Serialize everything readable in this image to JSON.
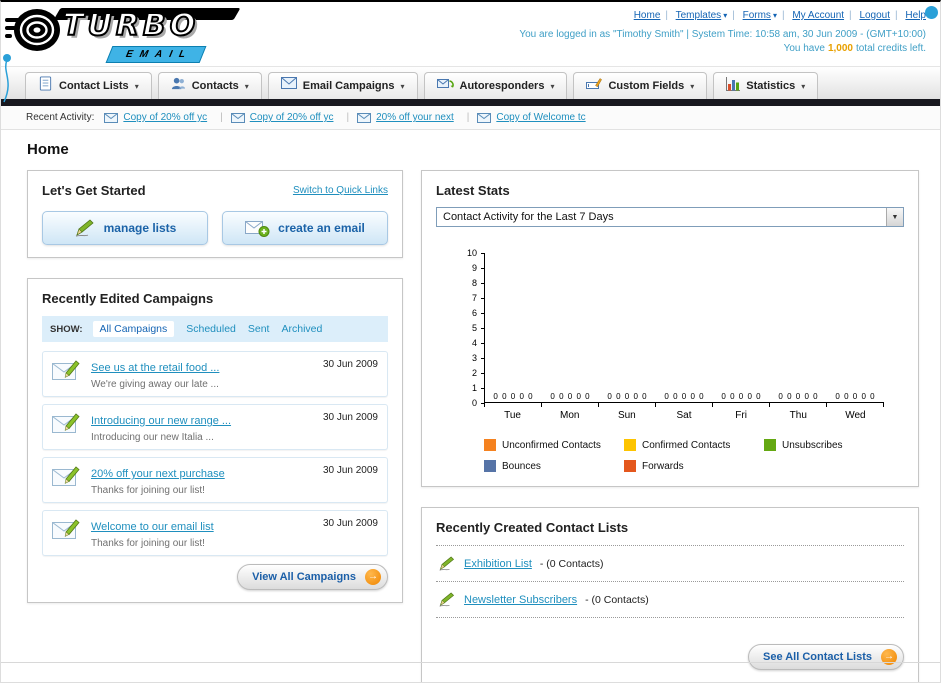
{
  "page_title": "Home",
  "header": {
    "logo_line1": "TURBO",
    "logo_line2": "EMAIL",
    "top_links": [
      {
        "label": "Home",
        "dropdown": false
      },
      {
        "label": "Templates",
        "dropdown": true
      },
      {
        "label": "Forms",
        "dropdown": true
      },
      {
        "label": "My Account",
        "dropdown": false
      },
      {
        "label": "Logout",
        "dropdown": false
      },
      {
        "label": "Help",
        "dropdown": false
      }
    ],
    "login_info": "You are logged in as \"Timothy Smith\" | System Time: 10:58 am, 30 Jun 2009 - (GMT+10:00)",
    "credits": {
      "prefix": "You have",
      "value": "1,000",
      "suffix": "total credits left."
    }
  },
  "nav": {
    "tabs": [
      {
        "label": "Contact Lists",
        "icon": "contact-lists-icon"
      },
      {
        "label": "Contacts",
        "icon": "contacts-icon"
      },
      {
        "label": "Email Campaigns",
        "icon": "email-campaigns-icon"
      },
      {
        "label": "Autoresponders",
        "icon": "autoresponders-icon"
      },
      {
        "label": "Custom Fields",
        "icon": "custom-fields-icon"
      },
      {
        "label": "Statistics",
        "icon": "statistics-icon"
      }
    ]
  },
  "recent_activity": {
    "label": "Recent Activity:",
    "items": [
      "Copy of 20% off yc",
      "Copy of 20% off yc",
      "20% off your next",
      "Copy of Welcome tc"
    ]
  },
  "get_started": {
    "title": "Let's Get Started",
    "switch_link": "Switch to Quick Links",
    "manage_lists_label": "manage lists",
    "create_email_label": "create an email"
  },
  "campaigns": {
    "title": "Recently Edited Campaigns",
    "show_label": "SHOW:",
    "filters": [
      "All Campaigns",
      "Scheduled",
      "Sent",
      "Archived"
    ],
    "selected_filter": "All Campaigns",
    "items": [
      {
        "title": "See us at the retail food ...",
        "subtitle": "We're giving away our late ...",
        "date": "30 Jun 2009"
      },
      {
        "title": "Introducing our new range ...",
        "subtitle": "Introducing our new Italia ...",
        "date": "30 Jun 2009"
      },
      {
        "title": "20% off your next purchase",
        "subtitle": "Thanks for joining our list!",
        "date": "30 Jun 2009"
      },
      {
        "title": "Welcome to our email list",
        "subtitle": "Thanks for joining our list!",
        "date": "30 Jun 2009"
      }
    ],
    "view_all_label": "View All Campaigns"
  },
  "stats": {
    "title": "Latest Stats",
    "selected_option": "Contact Activity for the Last 7 Days"
  },
  "contact_lists": {
    "title": "Recently Created Contact Lists",
    "items": [
      {
        "name": "Exhibition List",
        "meta": "- (0 Contacts)"
      },
      {
        "name": "Newsletter Subscribers",
        "meta": "- (0 Contacts)"
      }
    ],
    "see_all_label": "See All Contact Lists"
  },
  "chart_data": {
    "type": "bar",
    "title": "Contact Activity for the Last 7 Days",
    "categories": [
      "Tue",
      "Mon",
      "Sun",
      "Sat",
      "Fri",
      "Thu",
      "Wed"
    ],
    "series": [
      {
        "name": "Unconfirmed Contacts",
        "color": "#f5821f",
        "values": [
          0,
          0,
          0,
          0,
          0,
          0,
          0
        ]
      },
      {
        "name": "Confirmed Contacts",
        "color": "#fdc400",
        "values": [
          0,
          0,
          0,
          0,
          0,
          0,
          0
        ]
      },
      {
        "name": "Unsubscribes",
        "color": "#64a812",
        "values": [
          0,
          0,
          0,
          0,
          0,
          0,
          0
        ]
      },
      {
        "name": "Bounces",
        "color": "#5674a7",
        "values": [
          0,
          0,
          0,
          0,
          0,
          0,
          0
        ]
      },
      {
        "name": "Forwards",
        "color": "#e4571d",
        "values": [
          0,
          0,
          0,
          0,
          0,
          0,
          0
        ]
      }
    ],
    "xlabel": "",
    "ylabel": "",
    "ylim": [
      0,
      10
    ],
    "yticks": [
      0,
      1,
      2,
      3,
      4,
      5,
      6,
      7,
      8,
      9,
      10
    ],
    "grid": false,
    "legend_position": "bottom"
  }
}
